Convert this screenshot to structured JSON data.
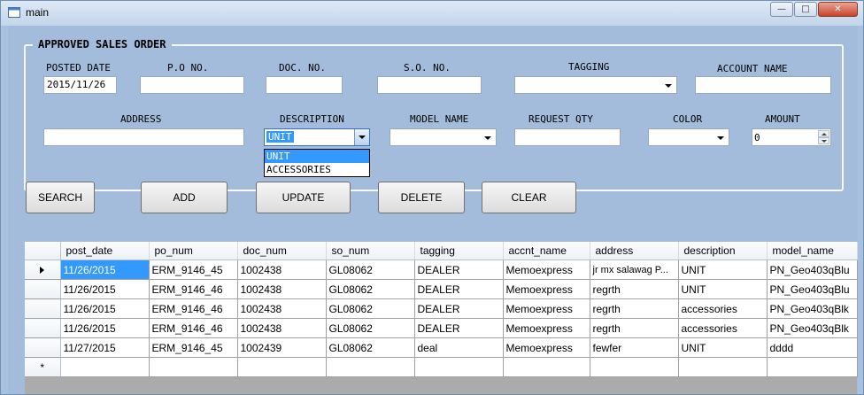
{
  "window": {
    "title": "main"
  },
  "form": {
    "group_title": "APPROVED SALES ORDER",
    "labels": {
      "posted_date": "POSTED DATE",
      "po_no": "P.O NO.",
      "doc_no": "DOC. NO.",
      "so_no": "S.O. NO.",
      "tagging": "TAGGING",
      "account_name": "ACCOUNT NAME",
      "address": "ADDRESS",
      "description": "DESCRIPTION",
      "model_name": "MODEL NAME",
      "request_qty": "REQUEST QTY",
      "color": "COLOR",
      "amount": "AMOUNT"
    },
    "values": {
      "posted_date": "2015/11/26",
      "po_no": "",
      "doc_no": "",
      "so_no": "",
      "tagging": "",
      "account_name": "",
      "address": "",
      "description": "UNIT",
      "model_name": "",
      "request_qty": "",
      "color": "",
      "amount": "0"
    },
    "description_options": [
      "UNIT",
      "ACCESSORIES"
    ]
  },
  "buttons": {
    "search": "SEARCH",
    "add": "ADD",
    "update": "UPDATE",
    "delete": "DELETE",
    "clear": "CLEAR"
  },
  "grid": {
    "columns": [
      "post_date",
      "po_num",
      "doc_num",
      "so_num",
      "tagging",
      "accnt_name",
      "address",
      "description",
      "model_name"
    ],
    "rows": [
      [
        "11/26/2015",
        "ERM_9146_45",
        "1002438",
        "GL08062",
        "DEALER",
        "Memoexpress",
        "jr mx salawag    P...",
        "UNIT",
        "PN_Geo403qBlu"
      ],
      [
        "11/26/2015",
        "ERM_9146_46",
        "1002438",
        "GL08062",
        "DEALER",
        "Memoexpress",
        "regrth",
        "UNIT",
        "PN_Geo403qBlu"
      ],
      [
        "11/26/2015",
        "ERM_9146_46",
        "1002438",
        "GL08062",
        "DEALER",
        "Memoexpress",
        "regrth",
        "accessories",
        "PN_Geo403qBlk"
      ],
      [
        "11/26/2015",
        "ERM_9146_46",
        "1002438",
        "GL08062",
        "DEALER",
        "Memoexpress",
        "regrth",
        "accessories",
        "PN_Geo403qBlk"
      ],
      [
        "11/27/2015",
        "ERM_9146_45",
        "1002439",
        "GL08062",
        "deal",
        "Memoexpress",
        "fewfer",
        "UNIT",
        "dddd"
      ]
    ],
    "new_row_marker": "*"
  }
}
